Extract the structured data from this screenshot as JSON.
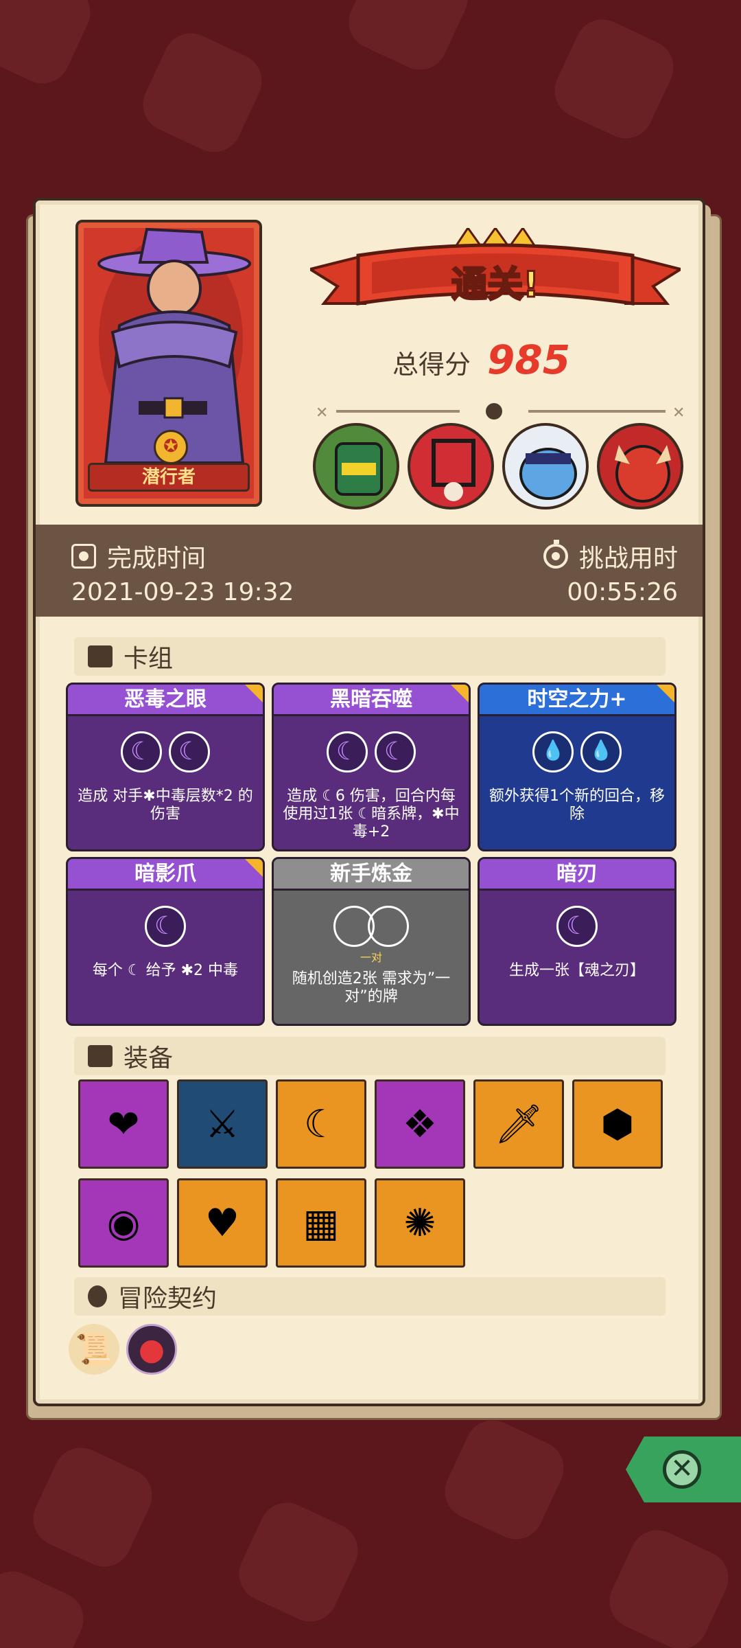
{
  "character": {
    "name": "潜行者"
  },
  "result": {
    "banner": "通关!",
    "score_label": "总得分",
    "score_value": "985"
  },
  "time": {
    "complete_label": "完成时间",
    "complete_value": "2021-09-23 19:32",
    "challenge_label": "挑战用时",
    "challenge_value": "00:55:26"
  },
  "sections": {
    "deck": "卡组",
    "equipment": "装备",
    "contract": "冒险契约"
  },
  "cards": [
    {
      "title": "恶毒之眼",
      "color": "purple",
      "desc": "造成 对手✱中毒层数*2 的伤害",
      "sub": ""
    },
    {
      "title": "黑暗吞噬",
      "color": "purple",
      "desc": "造成 ☾6 伤害，回合内每使用过1张 ☾暗系牌，✱中毒+2",
      "sub": ""
    },
    {
      "title": "时空之力+",
      "color": "blue",
      "desc": "额外获得1个新的回合，移除",
      "sub": ""
    },
    {
      "title": "暗影爪",
      "color": "purple",
      "desc": "每个 ☾ 给予 ✱2 中毒",
      "sub": ""
    },
    {
      "title": "新手炼金",
      "color": "gray",
      "desc": "随机创造2张 需求为”一对”的牌",
      "sub": "一对"
    },
    {
      "title": "暗刃",
      "color": "purple",
      "desc": "生成一张【魂之刃】",
      "sub": ""
    }
  ],
  "equipment_icons": [
    "heart-charm-icon",
    "scythe-blade-icon",
    "moon-charm-icon",
    "armor-icon",
    "dagger-icon",
    "shield-icon",
    "button-icon",
    "heart-potion-icon",
    "sweater-icon",
    "flame-orb-icon"
  ],
  "colors": {
    "accent_red": "#e63a2b",
    "panel": "#f8ecd2",
    "strip": "#6b5444"
  }
}
